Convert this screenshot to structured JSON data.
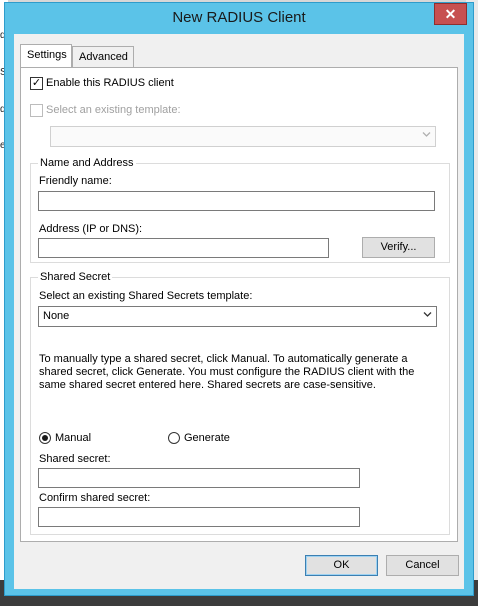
{
  "background": {
    "left_fragments": [
      "d",
      "S",
      "d",
      "er"
    ]
  },
  "window": {
    "title": "New RADIUS Client",
    "close_glyph": "✕"
  },
  "tabs": [
    {
      "label": "Settings",
      "active": true
    },
    {
      "label": "Advanced",
      "active": false
    }
  ],
  "settings": {
    "enable_client": {
      "label": "Enable this RADIUS client",
      "checked": true,
      "check_glyph": "✓"
    },
    "select_template": {
      "label": "Select an existing template:",
      "checked": false,
      "enabled": false,
      "value": ""
    },
    "name_and_address": {
      "title": "Name and Address",
      "friendly_name_label": "Friendly name:",
      "friendly_name_value": "",
      "address_label": "Address (IP or DNS):",
      "address_value": "",
      "verify_button": "Verify..."
    },
    "shared_secret": {
      "title": "Shared Secret",
      "template_label": "Select an existing Shared Secrets template:",
      "template_value": "None",
      "description": "To manually type a shared secret, click Manual. To automatically generate a shared secret, click Generate. You must configure the RADIUS client with the same shared secret entered here. Shared secrets are case-sensitive.",
      "manual_label": "Manual",
      "manual_selected": true,
      "generate_label": "Generate",
      "generate_selected": false,
      "secret_label": "Shared secret:",
      "secret_value": "",
      "confirm_label": "Confirm shared secret:",
      "confirm_value": ""
    }
  },
  "footer": {
    "ok_button": "OK",
    "cancel_button": "Cancel"
  },
  "icons": {
    "dropdown": "chevron-down-icon",
    "close": "close-icon",
    "check": "checkmark-icon"
  }
}
